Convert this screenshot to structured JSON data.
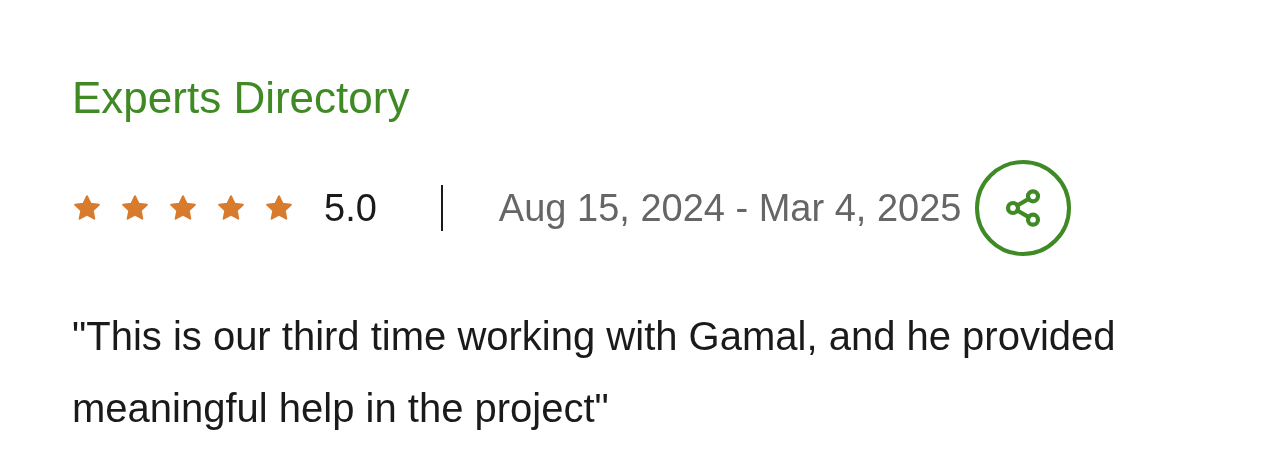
{
  "title": "Experts Directory",
  "rating": {
    "stars": 5,
    "score": "5.0"
  },
  "date_range": "Aug 15, 2024 - Mar 4, 2025",
  "quote": "\"This is our third time working with Gamal, and he provided meaningful help in the project\""
}
